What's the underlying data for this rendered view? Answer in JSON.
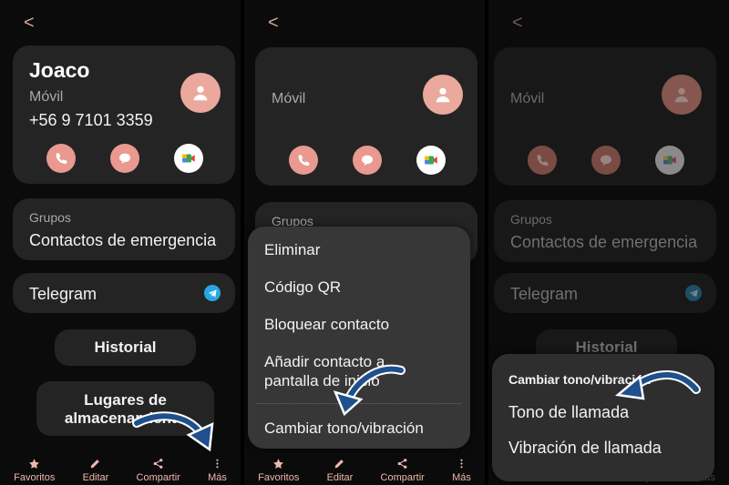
{
  "screens": [
    {
      "back": "<",
      "contact": {
        "name": "Joaco",
        "label": "Móvil",
        "phone": "+56 9 7101 3359"
      },
      "group": {
        "label": "Grupos",
        "value": "Contactos de emergencia"
      },
      "telegram": "Telegram",
      "history_button": "Historial",
      "storage_button_line1": "Lugares de",
      "storage_button_line2": "almacenamiento"
    },
    {
      "back": "<",
      "contact": {
        "label": "Móvil"
      },
      "group": {
        "label": "Grupos"
      },
      "menu": [
        "Eliminar",
        "Código QR",
        "Bloquear contacto",
        "Añadir contacto a",
        "pantalla de inicio",
        "Cambiar tono/vibración"
      ]
    },
    {
      "back": "<",
      "contact": {
        "label": "Móvil"
      },
      "group": {
        "label": "Grupos",
        "value": "Contactos de emergencia"
      },
      "telegram": "Telegram",
      "history_button": "Historial",
      "sheet": {
        "title": "Cambiar tono/vibración",
        "items": [
          "Tono de llamada",
          "Vibración de llamada"
        ]
      }
    }
  ],
  "nav": [
    "Favoritos",
    "Editar",
    "Compartir",
    "Más"
  ],
  "colors": {
    "accent": "#e9998f",
    "card": "#242424",
    "menu": "#373737",
    "arrow": "#1f4f8c"
  }
}
